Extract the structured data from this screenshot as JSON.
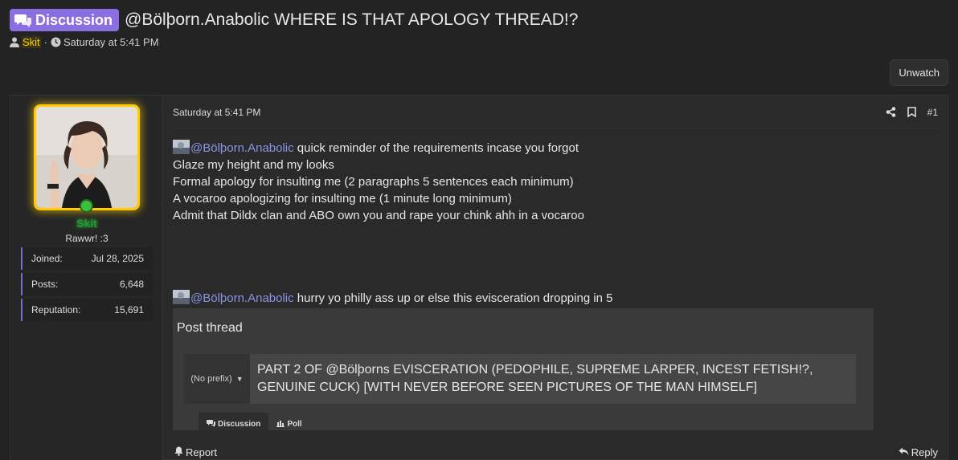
{
  "thread": {
    "prefix_label": "Discussion",
    "title": "@Bölþorn.Anabolic WHERE IS THAT APOLOGY THREAD!?",
    "author": "Skit",
    "date": "Saturday at 5:41 PM",
    "unwatch_label": "Unwatch"
  },
  "user": {
    "name": "Skit",
    "title": "Rawwr! :3",
    "stats": [
      {
        "label": "Joined:",
        "value": "Jul 28, 2025"
      },
      {
        "label": "Posts:",
        "value": "6,648"
      },
      {
        "label": "Reputation:",
        "value": "15,691"
      }
    ]
  },
  "message": {
    "date": "Saturday at 5:41 PM",
    "post_number": "#1",
    "mention": "@Bölþorn.Anabolic",
    "line1_rest": " quick reminder of the requirements incase you forgot",
    "lines": [
      "Glaze my height and my looks",
      "Formal apology for insulting me (2 paragraphs 5 sentences each minimum)",
      "A vocaroo apologizing for insulting me (1 minute long minimum)",
      "Admit that Dildx clan and ABO own you and rape your chink ahh in a vocaroo"
    ],
    "mention2": "@Bölþorn.Anabolic",
    "line2_rest": " hurry yo philly ass up or else this evisceration dropping in 5"
  },
  "embed": {
    "title": "Post thread",
    "prefix_select": "(No prefix)",
    "thread_title_value": "PART 2 OF @Bölþorns EVISCERATION (PEDOPHILE, SUPREME LARPER, INCEST FETISH!?, GENUINE CUCK) [WITH NEVER BEFORE SEEN PICTURES OF THE MAN HIMSELF]",
    "tabs": [
      "Discussion",
      "Poll"
    ]
  },
  "footer": {
    "report_label": "Report",
    "reply_label": "Reply"
  },
  "colors": {
    "prefix_bg": "#8b6fe0",
    "username_highlight": "#ffd200",
    "avatar_border": "#ffcc00",
    "online_green": "#3fbf3f",
    "mention": "#8a94e6"
  }
}
